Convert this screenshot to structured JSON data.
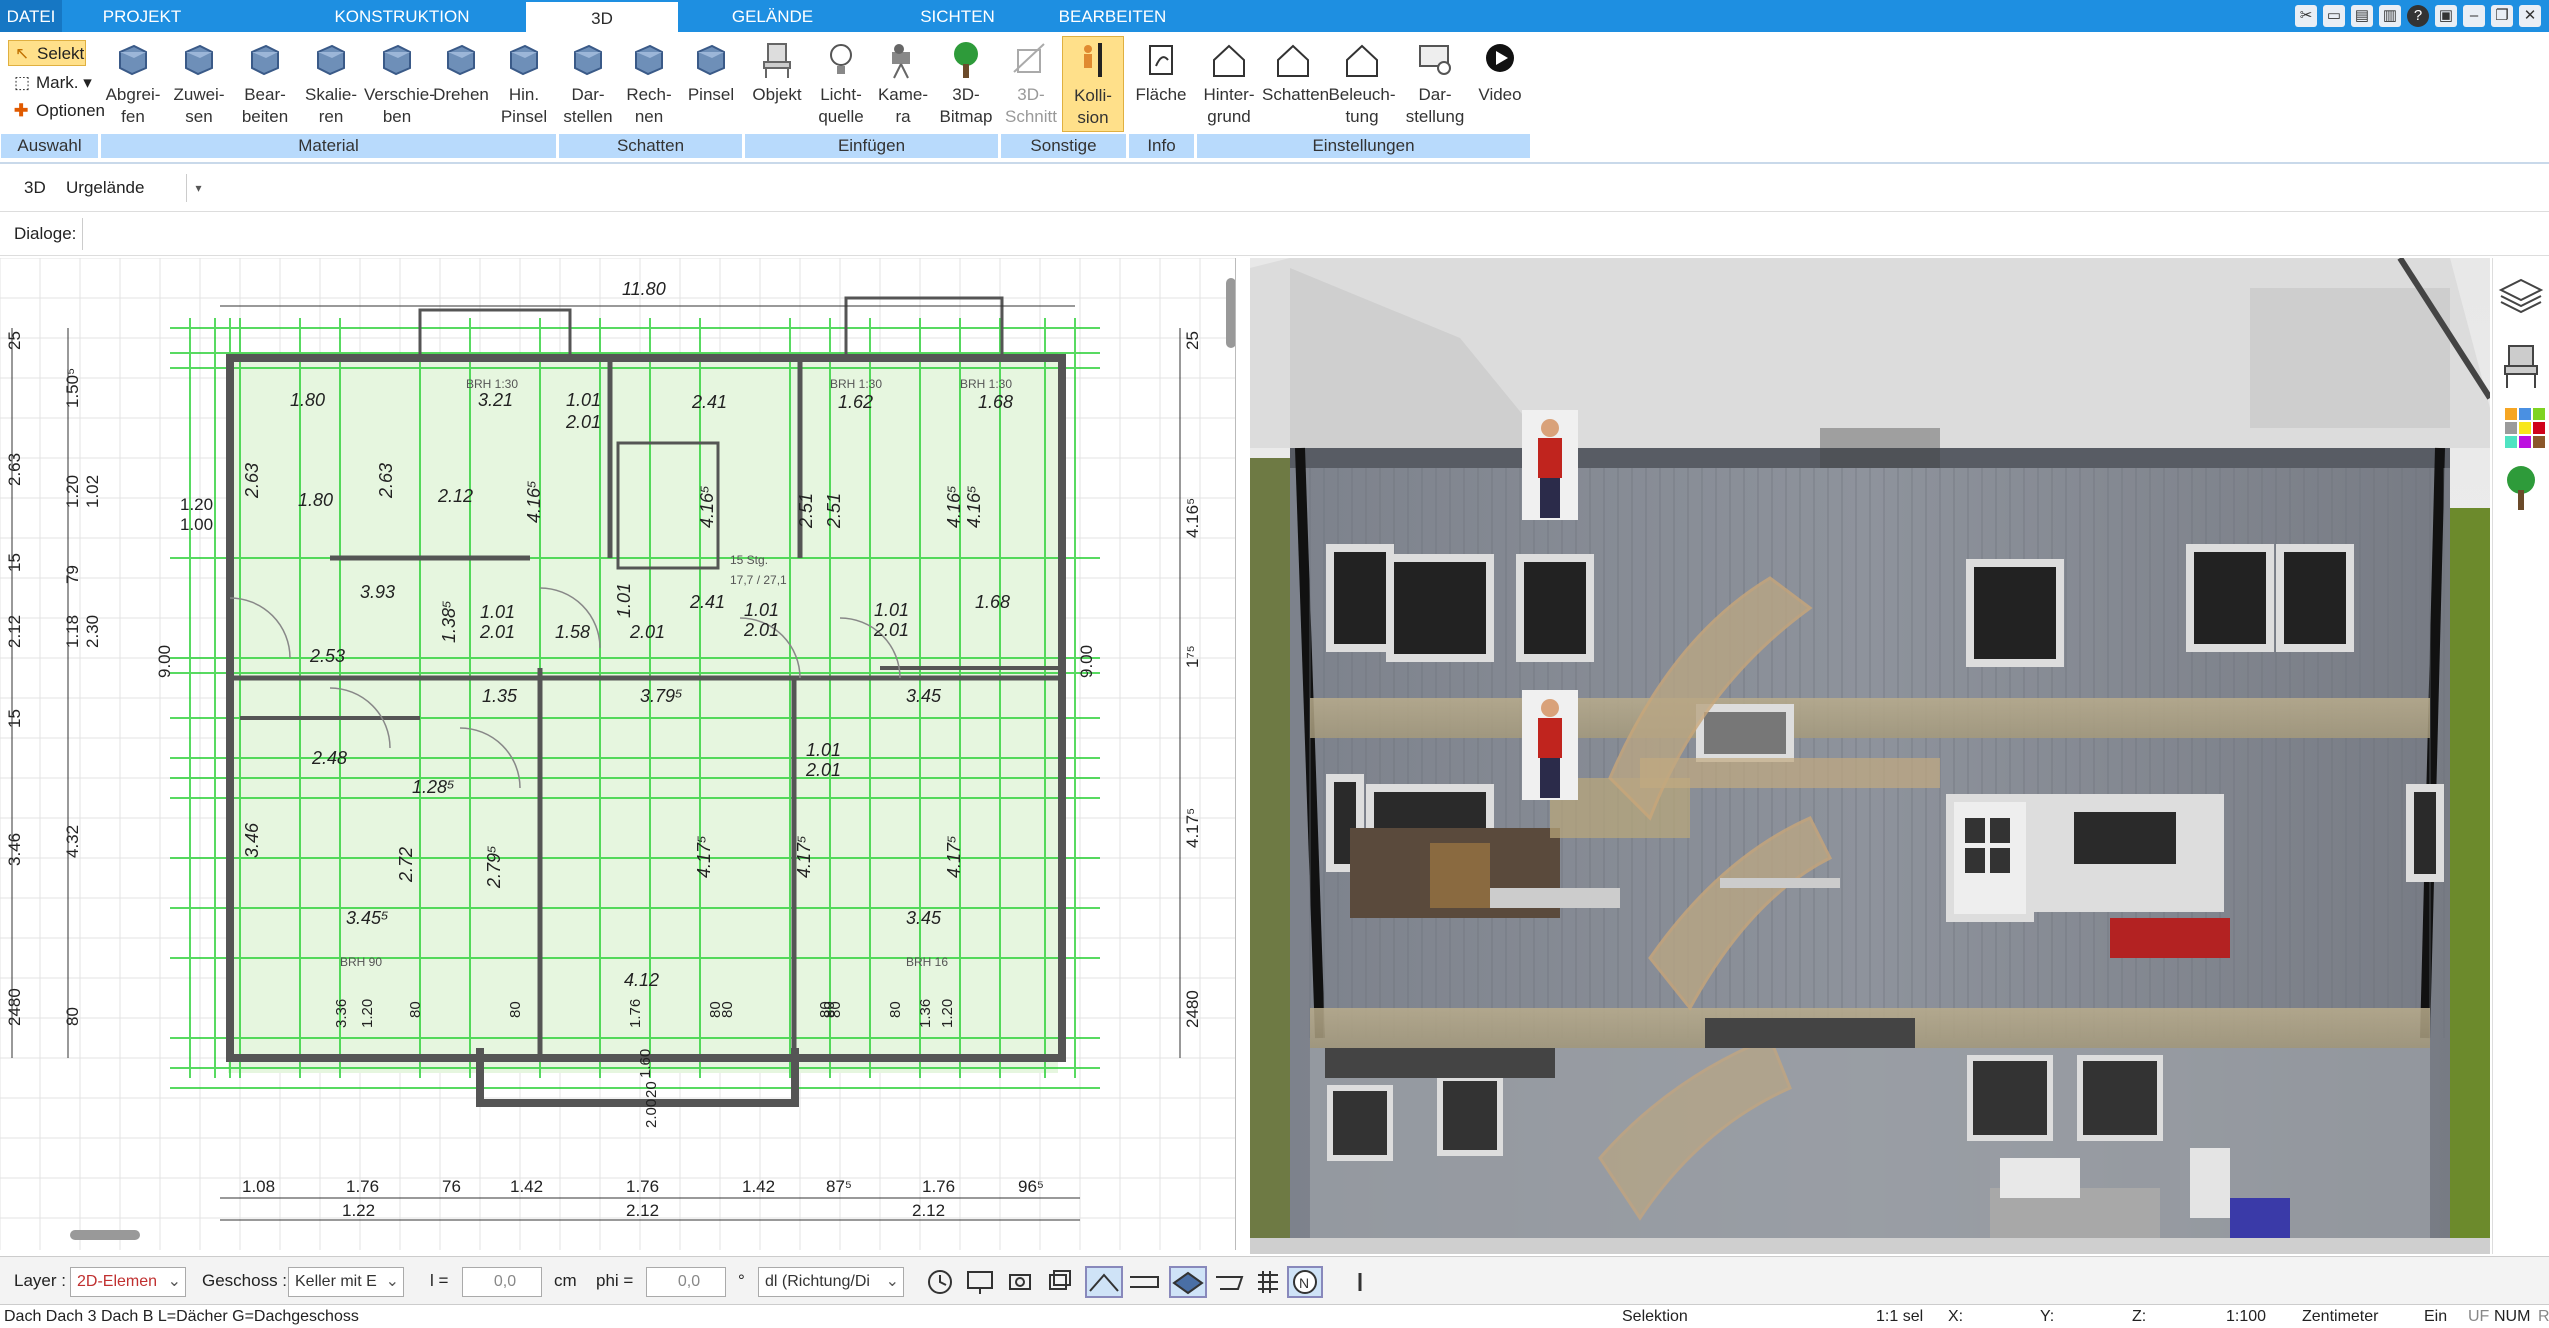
{
  "menu": {
    "tabs": [
      "DATEI",
      "PROJEKT",
      "KONSTRUKTION",
      "3D",
      "GELÄNDE",
      "SICHTEN",
      "BEARBEITEN"
    ],
    "active": "3D"
  },
  "ribbon": {
    "auswahl": {
      "label": "Auswahl",
      "selekt": "Selekt",
      "mark": "Mark.",
      "optionen": "Optionen"
    },
    "material": {
      "label": "Material",
      "buttons": [
        {
          "l1": "Abgrei-",
          "l2": "fen"
        },
        {
          "l1": "Zuwei-",
          "l2": "sen"
        },
        {
          "l1": "Bear-",
          "l2": "beiten"
        },
        {
          "l1": "Skalie-",
          "l2": "ren"
        },
        {
          "l1": "Verschie-",
          "l2": "ben"
        },
        {
          "l1": "Drehen",
          "l2": ""
        },
        {
          "l1": "Hin.",
          "l2": "Pinsel"
        }
      ]
    },
    "schatten": {
      "label": "Schatten",
      "buttons": [
        {
          "l1": "Dar-",
          "l2": "stellen"
        },
        {
          "l1": "Rech-",
          "l2": "nen"
        },
        {
          "l1": "Pinsel",
          "l2": ""
        }
      ]
    },
    "einfuegen": {
      "label": "Einfügen",
      "buttons": [
        {
          "l1": "Objekt",
          "l2": ""
        },
        {
          "l1": "Licht-",
          "l2": "quelle"
        },
        {
          "l1": "Kame-",
          "l2": "ra"
        },
        {
          "l1": "3D-",
          "l2": "Bitmap"
        }
      ]
    },
    "sonstige": {
      "label": "Sonstige",
      "buttons": [
        {
          "l1": "3D-",
          "l2": "Schnitt"
        },
        {
          "l1": "Kolli-",
          "l2": "sion"
        }
      ]
    },
    "info": {
      "label": "Info",
      "buttons": [
        {
          "l1": "Fläche",
          "l2": ""
        }
      ]
    },
    "einstellungen": {
      "label": "Einstellungen",
      "buttons": [
        {
          "l1": "Hinter-",
          "l2": "grund"
        },
        {
          "l1": "Schatten",
          "l2": ""
        },
        {
          "l1": "Beleuch-",
          "l2": "tung"
        },
        {
          "l1": "Dar-",
          "l2": "stellung"
        },
        {
          "l1": "Video",
          "l2": ""
        }
      ]
    }
  },
  "row1": {
    "mode": "3D",
    "terrain": "Urgelände"
  },
  "row2": {
    "dialoge": "Dialoge:"
  },
  "plan": {
    "top_dim": "11.80",
    "labels": [
      {
        "t": "1.80"
      },
      {
        "t": "3.21"
      },
      {
        "t": "1.01"
      },
      {
        "t": "2.01"
      },
      {
        "t": "2.41"
      },
      {
        "t": "1.62"
      },
      {
        "t": "1.68"
      },
      {
        "t": "2.63"
      },
      {
        "t": "2.63"
      },
      {
        "t": "1.80"
      },
      {
        "t": "2.12"
      },
      {
        "t": "4.16⁵"
      },
      {
        "t": "4.16⁵"
      },
      {
        "t": "2.51"
      },
      {
        "t": "2.51"
      },
      {
        "t": "4.16⁵"
      },
      {
        "t": "4.16⁵"
      },
      {
        "t": "3.93"
      },
      {
        "t": "1.38⁵"
      },
      {
        "t": "1.01"
      },
      {
        "t": "2.01"
      },
      {
        "t": "1.58"
      },
      {
        "t": "1.01"
      },
      {
        "t": "2.01"
      },
      {
        "t": "2.41"
      },
      {
        "t": "1.01"
      },
      {
        "t": "2.01"
      },
      {
        "t": "1.01"
      },
      {
        "t": "2.01"
      },
      {
        "t": "1.68"
      },
      {
        "t": "2.53"
      },
      {
        "t": "1.35"
      },
      {
        "t": "3.79⁵"
      },
      {
        "t": "3.45"
      },
      {
        "t": "2.48"
      },
      {
        "t": "1.28⁵"
      },
      {
        "t": "1.01"
      },
      {
        "t": "2.01"
      },
      {
        "t": "3.46"
      },
      {
        "t": "2.72"
      },
      {
        "t": "2.79⁵"
      },
      {
        "t": "4.17⁵"
      },
      {
        "t": "4.17⁵"
      },
      {
        "t": "4.17⁵"
      },
      {
        "t": "3.45⁵"
      },
      {
        "t": "3.45"
      },
      {
        "t": "4.12"
      },
      {
        "t": "BRH 1:30"
      },
      {
        "t": "BRH 1:30"
      },
      {
        "t": "BRH 1:30"
      },
      {
        "t": "BRH 90"
      },
      {
        "t": "BRH 16"
      },
      {
        "t": "15 Stg."
      },
      {
        "t": "17,7 / 27,1"
      }
    ],
    "left_dims": [
      "25",
      "1.50⁵",
      "2.63",
      "1.20",
      "1.02",
      "15",
      "79",
      "2.12",
      "1.18",
      "2.30",
      "15",
      "3.46",
      "4.32",
      "2480",
      "80",
      "1.20",
      "1.00",
      "9.00"
    ],
    "right_dims": [
      "25",
      "4.16⁵",
      "1⁷⁵",
      "4.17⁵",
      "2480",
      "9.00"
    ],
    "bottom_row1": [
      "1.08",
      "1.76",
      "76",
      "1.42",
      "1.76",
      "1.42",
      "87⁵",
      "1.76",
      "96⁵"
    ],
    "bottom_row2": [
      "1.22",
      "2.12",
      "2.12"
    ],
    "bottom_misc": [
      "3.36",
      "1.20",
      "80",
      "80",
      "80",
      "80",
      "1.36",
      "1.20",
      "1.76",
      "1.60",
      "20",
      "2.00",
      "80",
      "80",
      "80",
      "80"
    ]
  },
  "statusbar": {
    "layer_label": "Layer :",
    "layer_value": "2D-Elemen",
    "geschoss_label": "Geschoss :",
    "geschoss_value": "Keller mit E",
    "l_label": "l =",
    "l_value": "0,0",
    "cm": "cm",
    "phi_label": "phi =",
    "phi_value": "0,0",
    "deg": "°",
    "dl_value": "dl (Richtung/Di"
  },
  "statusbar2": {
    "left": "Dach Dach 3 Dach B L=Dächer G=Dachgeschoss",
    "selektion": "Selektion",
    "sel": "1:1 sel",
    "x": "X:",
    "y": "Y:",
    "z": "Z:",
    "scale": "1:100",
    "unit": "Zentimeter",
    "ein": "Ein",
    "uf": "UF",
    "num": "NUM",
    "r": "R"
  },
  "colors": {
    "menubar": "#1e8fe1",
    "group_label": "#b8dafc",
    "selected": "#ffe08a",
    "plan_green": "#2fd13a"
  }
}
